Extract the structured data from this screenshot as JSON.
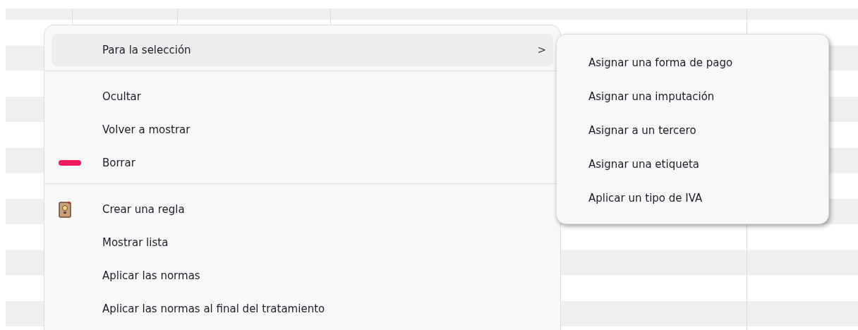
{
  "context_menu": {
    "items": [
      {
        "kind": "submenu",
        "label": "Para la selección",
        "selected": true,
        "arrow": ">"
      },
      {
        "kind": "separator"
      },
      {
        "kind": "item",
        "label": "Ocultar",
        "selected": false
      },
      {
        "kind": "item",
        "label": "Volver a mostrar",
        "selected": false
      },
      {
        "kind": "delete",
        "label": "Borrar",
        "selected": false
      },
      {
        "kind": "separator"
      },
      {
        "kind": "rule",
        "label": "Crear una regla",
        "selected": false
      },
      {
        "kind": "item",
        "label": "Mostrar lista",
        "selected": false
      },
      {
        "kind": "item",
        "label": "Aplicar las normas",
        "selected": false
      },
      {
        "kind": "item",
        "label": "Aplicar las normas al final del tratamiento",
        "selected": false
      }
    ]
  },
  "submenu": {
    "items": [
      {
        "label": "Asignar una forma de pago"
      },
      {
        "label": "Asignar una imputación"
      },
      {
        "label": "Asignar a un tercero"
      },
      {
        "label": "Asignar una etiqueta"
      },
      {
        "label": "Aplicar un tipo de IVA"
      }
    ]
  }
}
